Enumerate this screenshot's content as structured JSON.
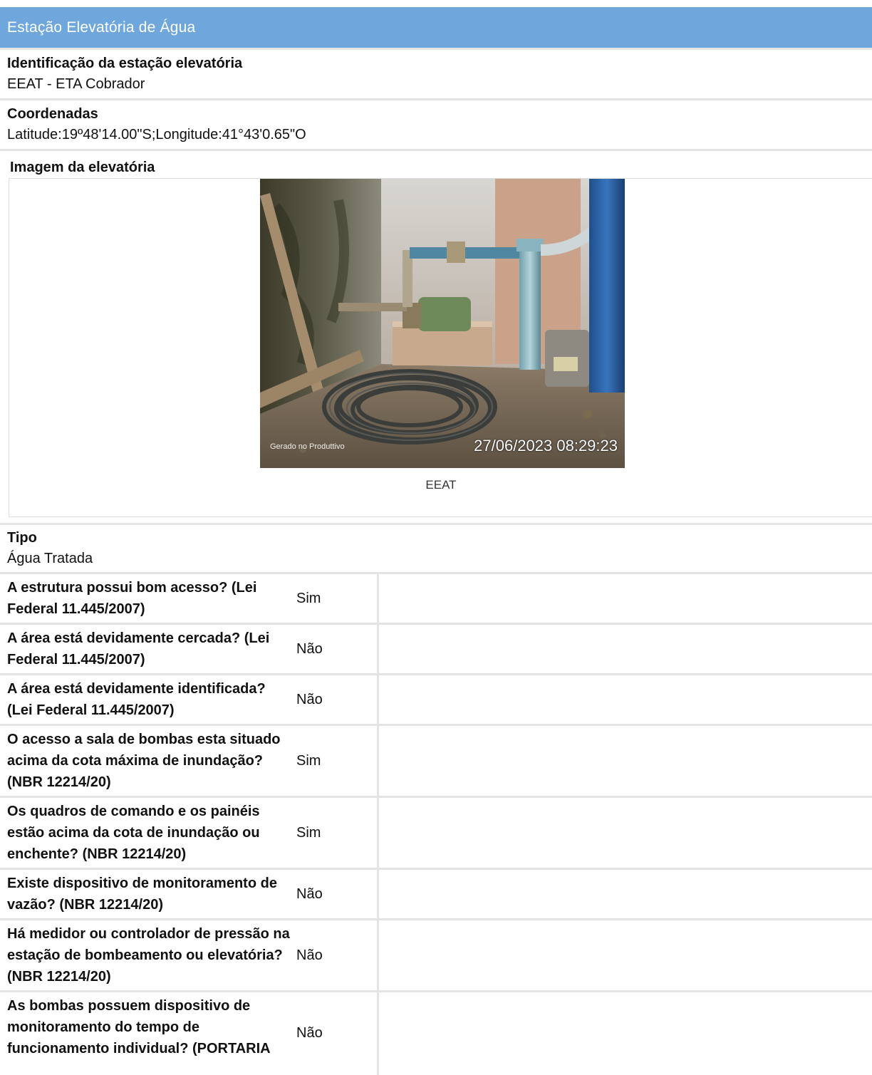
{
  "section": {
    "title": "Estação Elevatória de Água"
  },
  "identification": {
    "label": "Identificação da estação elevatória",
    "value": "EEAT - ETA Cobrador"
  },
  "coordinates": {
    "label": "Coordenadas",
    "value": "Latitude:19º48'14.00\"S;Longitude:41°43'0.65\"O"
  },
  "image": {
    "label": "Imagem da elevatória",
    "watermark": "Gerado no Produttivo",
    "timestamp": "27/06/2023 08:29:23",
    "caption": "EEAT"
  },
  "type": {
    "label": "Tipo",
    "value": "Água Tratada"
  },
  "questions": [
    {
      "q": "A estrutura possui bom acesso? (Lei Federal 11.445/2007)",
      "a": "Sim"
    },
    {
      "q": "A área está devidamente cercada? (Lei Federal 11.445/2007)",
      "a": "Não"
    },
    {
      "q": "A área está devidamente identificada? (Lei Federal 11.445/2007)",
      "a": "Não"
    },
    {
      "q": "O acesso a sala de bombas esta situado acima da cota máxima de inundação? (NBR 12214/20)",
      "a": "Sim"
    },
    {
      "q": "Os quadros de comando e os painéis estão acima da cota de inundação ou enchente? (NBR 12214/20)",
      "a": "Sim"
    },
    {
      "q": "Existe dispositivo de monitoramento de vazão? (NBR 12214/20)",
      "a": "Não"
    },
    {
      "q": "Há medidor ou controlador de pressão na estação de bombeamento ou elevatória? (NBR 12214/20)",
      "a": "Não"
    },
    {
      "q": "As bombas possuem dispositivo de monitoramento do tempo de funcionamento individual? (PORTARIA",
      "a": "Não"
    }
  ]
}
